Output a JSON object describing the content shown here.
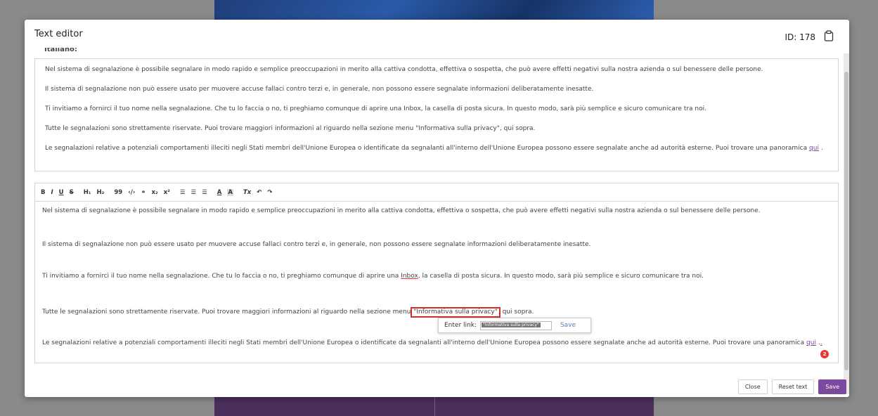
{
  "modal": {
    "title": "Text editor",
    "id_label": "ID: 178"
  },
  "content": {
    "language_label": "Italiano:",
    "paragraphs": [
      "Nel sistema di segnalazione è possibile segnalare in modo rapido e semplice preoccupazioni in merito alla cattiva condotta, effettiva o sospetta, che può avere effetti negativi sulla nostra azienda o sul benessere delle persone.",
      "Il sistema di segnalazione non può essere usato per muovere accuse fallaci contro terzi e, in generale, non possono essere segnalate informazioni deliberatamente inesatte.",
      "Ti invitiamo a fornirci il tuo nome nella segnalazione. Che tu lo faccia o no, ti preghiamo comunque di aprire una Inbox, la casella di posta sicura. In questo modo, sarà più semplice e sicuro comunicare tra noi.",
      "Tutte le segnalazioni sono strettamente riservate. Puoi trovare maggiori informazioni al riguardo nella sezione menu \"Informativa sulla privacy\", qui sopra.",
      "Le segnalazioni relative a potenziali comportamenti illeciti negli Stati membri dell'Unione Europea o identificate da segnalanti all'interno dell'Unione Europea possono essere segnalate anche ad autorità esterne. Puoi trovare una panoramica"
    ],
    "link_text": "qui",
    "link_suffix": " .",
    "editor": {
      "p3_before": "Ti invitiamo a fornirci il tuo nome nella segnalazione. Che tu lo faccia o no, ti preghiamo comunque di aprire una ",
      "p3_inbox": "Inbox",
      "p3_after": ", la casella di posta sicura. In questo modo, sarà più semplice e sicuro comunicare tra noi.",
      "p4_before": "Tutte le segnalazioni sono strettamente riservate. Puoi trovare maggiori informazioni al riguardo nella sezione menu ",
      "p4_selected": "\"Informativa sulla privacy\"",
      "p4_after": ", qui sopra.",
      "p5_suffix": "."
    }
  },
  "toolbar": {
    "bold": "B",
    "italic": "I",
    "underline": "U",
    "strike": "S",
    "h1": "H₁",
    "h2": "H₂",
    "quote": "99",
    "code": "‹/›",
    "link": "⚭",
    "subscript": "x₂",
    "superscript": "x²",
    "ordered_list": "☰",
    "bullet_list": "☰",
    "align": "☰",
    "text_color": "A",
    "highlight": "A",
    "clear_format": "Tx",
    "undo": "↶",
    "redo": "↷"
  },
  "link_popup": {
    "label": "Enter link:",
    "value": "\"Informativa sulla privacy\"",
    "save": "Save"
  },
  "badge_count": "2",
  "buttons": {
    "close": "Close",
    "reset": "Reset text",
    "save": "Save"
  },
  "colors": {
    "accent": "#7b4a9c",
    "link_save": "#5b7fc7",
    "error": "#e53935",
    "highlight_border": "#d32f2f"
  }
}
